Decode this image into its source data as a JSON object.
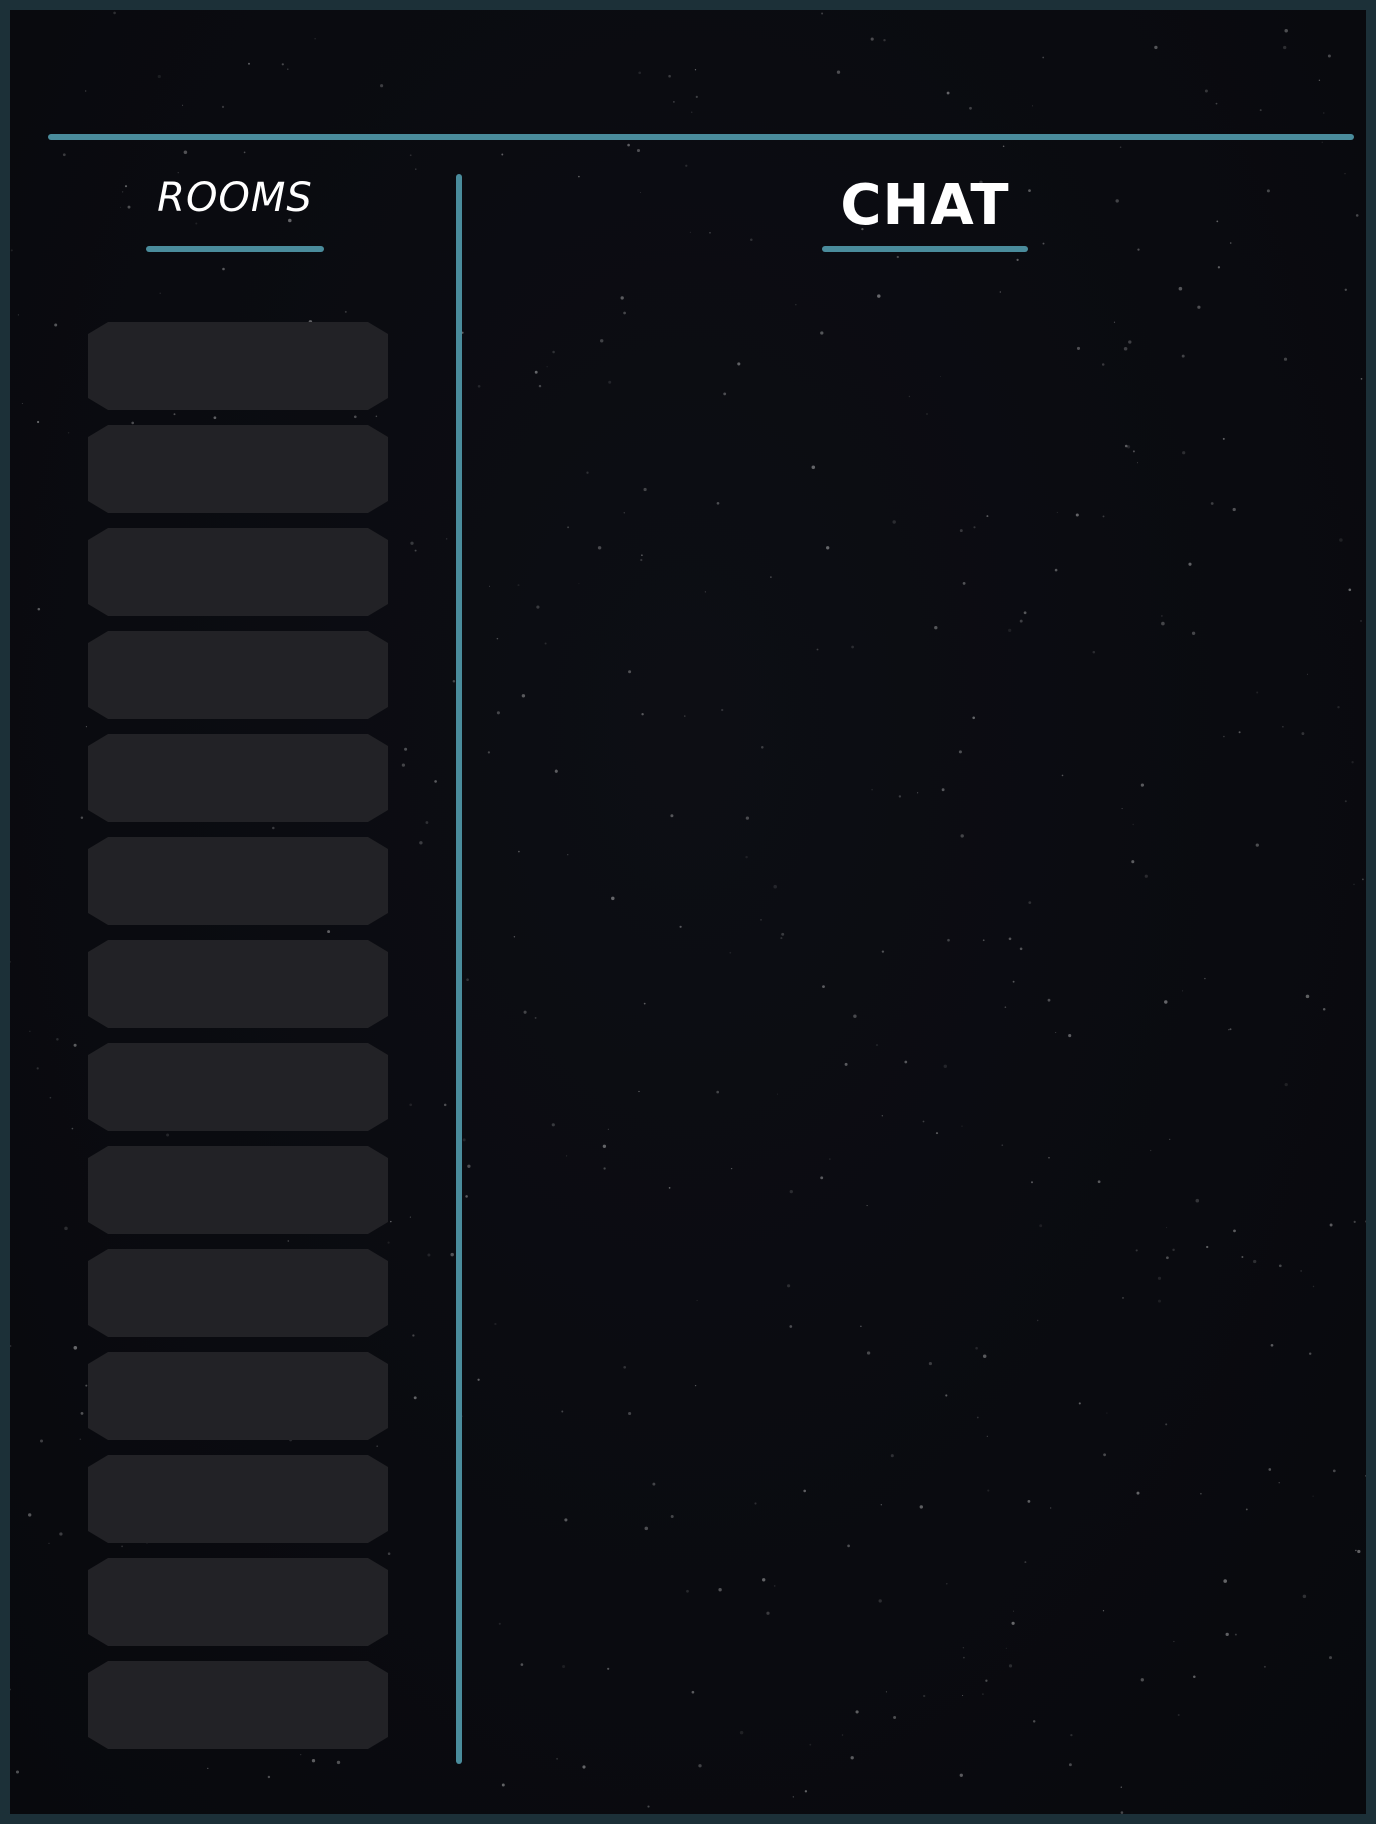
{
  "rooms": {
    "title": "ROOMS",
    "slots": [
      "",
      "",
      "",
      "",
      "",
      "",
      "",
      "",
      "",
      "",
      "",
      "",
      "",
      ""
    ]
  },
  "chat": {
    "title": "CHAT"
  },
  "colors": {
    "accent": "#4a8c9c",
    "background": "#0a0b10",
    "slot": "#222226",
    "text": "#ffffff"
  }
}
